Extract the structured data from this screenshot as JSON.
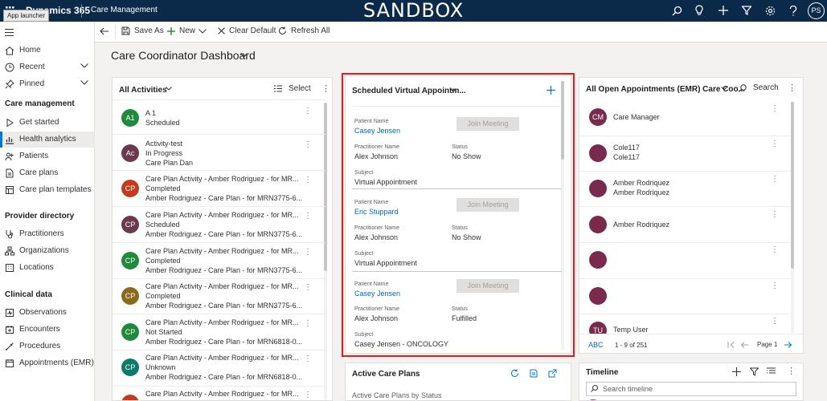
{
  "topbar": {
    "brand": "Dynamics 365",
    "app_name": "Care Management",
    "environment": "SANDBOX",
    "tooltip": "App launcher",
    "user_initials": "PS",
    "icons": [
      "search-icon",
      "lightbulb-icon",
      "plus-icon",
      "filter-icon",
      "gear-icon",
      "help-icon"
    ]
  },
  "sidebar": {
    "top_items": [
      {
        "label": "Home",
        "icon": "home-icon"
      },
      {
        "label": "Recent",
        "icon": "clock-icon"
      },
      {
        "label": "Pinned",
        "icon": "pin-icon"
      }
    ],
    "groups": [
      {
        "title": "Care management",
        "items": [
          {
            "label": "Get started",
            "icon": "play-icon"
          },
          {
            "label": "Health analytics",
            "icon": "chart-icon"
          },
          {
            "label": "Patients",
            "icon": "patients-icon"
          },
          {
            "label": "Care plans",
            "icon": "document-icon"
          },
          {
            "label": "Care plan templates",
            "icon": "template-icon"
          }
        ]
      },
      {
        "title": "Provider directory",
        "items": [
          {
            "label": "Practitioners",
            "icon": "stethoscope-icon"
          },
          {
            "label": "Organizations",
            "icon": "organization-icon"
          },
          {
            "label": "Locations",
            "icon": "location-icon"
          }
        ]
      },
      {
        "title": "Clinical data",
        "items": [
          {
            "label": "Observations",
            "icon": "observation-icon"
          },
          {
            "label": "Encounters",
            "icon": "encounter-icon"
          },
          {
            "label": "Procedures",
            "icon": "procedure-icon"
          },
          {
            "label": "Appointments (EMR)",
            "icon": "calendar-icon"
          }
        ]
      }
    ]
  },
  "commandbar": {
    "save_as": "Save As",
    "new": "New",
    "clear_default": "Clear Default",
    "refresh_all": "Refresh All"
  },
  "page": {
    "title": "Care Coordinator Dashboard"
  },
  "activities": {
    "title": "All Activities",
    "select_label": "Select",
    "rows": [
      {
        "initials": "A1",
        "color": "#1f8a3b",
        "l1": "A 1",
        "l2": "Scheduled",
        "l3": ""
      },
      {
        "initials": "Ac",
        "color": "#6b3a4f",
        "l1": "Activity-test",
        "l2": "In Progress",
        "l3": "Care Plan Dan"
      },
      {
        "initials": "CP",
        "color": "#c43b1c",
        "l1": "Care Plan Activity - Amber Rodriguez - for MR...",
        "l2": "Completed",
        "l3": "Amber Rodriguez - Care Plan - for MRN3775-6..."
      },
      {
        "initials": "CP",
        "color": "#6b3a4f",
        "l1": "Care Plan Activity - Amber Rodriguez - for MR...",
        "l2": "Scheduled",
        "l3": "Amber Rodriguez - Care Plan - for MRN3775-6..."
      },
      {
        "initials": "CP",
        "color": "#1f8a3b",
        "l1": "Care Plan Activity - Amber Rodriguez - for MR...",
        "l2": "Completed",
        "l3": "Amber Rodriguez - Care Plan - for MRN3775-6..."
      },
      {
        "initials": "CP",
        "color": "#8a6a1c",
        "l1": "Care Plan Activity - Amber Rodriguez - for MR...",
        "l2": "Completed",
        "l3": "Amber Rodriguez - Care Plan - for MRN3775-6..."
      },
      {
        "initials": "CP",
        "color": "#1f8a3b",
        "l1": "Care Plan Activity - Amber Rodriguez - for MR...",
        "l2": "Not Started",
        "l3": "Amber Rodriguez - Care Plan - for MRN6818-0..."
      },
      {
        "initials": "CP",
        "color": "#0e7a6a",
        "l1": "Care Plan Activity - Amber Rodriguez - for MR...",
        "l2": "Unknown",
        "l3": "Amber Rodriguez - Care Plan - for MRN6818-0..."
      },
      {
        "initials": "CP",
        "color": "#c43b1c",
        "l1": "Care Plan Activity - Amber Rodriguez - for MR...",
        "l2": "",
        "l3": ""
      }
    ]
  },
  "scheduled": {
    "title": "Scheduled Virtual Appointm...",
    "labels": {
      "patient": "Patient Name",
      "practitioner": "Practitioner Name",
      "status": "Status",
      "subject": "Subject",
      "join": "Join Meeting"
    },
    "cards": [
      {
        "patient": "Casey Jensen",
        "practitioner": "Alex Johnson",
        "status": "No Show",
        "subject": "Virtual Appointment"
      },
      {
        "patient": "Eric Stuppard",
        "practitioner": "Alex Johnson",
        "status": "No Show",
        "subject": "Virtual Appointment"
      },
      {
        "patient": "Casey Jensen",
        "practitioner": "Alex Johnson",
        "status": "Fulfilled",
        "subject": "Casey Jensen - ONCOLOGY"
      }
    ]
  },
  "emr": {
    "title": "All Open Appointments (EMR) Care Coo...",
    "search_label": "Search",
    "rows": [
      {
        "initials": "CM",
        "t1": "Care Manager",
        "t2": ""
      },
      {
        "initials": "",
        "t1": "Cole117",
        "t2": "Cole117"
      },
      {
        "initials": "",
        "t1": "Amber Rodriquez",
        "t2": "Amber Rodriquez"
      },
      {
        "initials": "",
        "t1": "Amber Rodriquez",
        "t2": ""
      },
      {
        "initials": "",
        "t1": "",
        "t2": ""
      },
      {
        "initials": "",
        "t1": "",
        "t2": ""
      },
      {
        "initials": "TU",
        "t1": "Temp User",
        "t2": ""
      }
    ],
    "footer": {
      "abc": "ABC",
      "range": "1 - 9 of 251",
      "page": "Page 1"
    }
  },
  "care_plans": {
    "title": "Active Care Plans",
    "subtitle": "Active Care Plans by Status"
  },
  "timeline": {
    "title": "Timeline",
    "search_placeholder": "Search timeline"
  },
  "colors": {
    "topbar": "#0b2a4a",
    "accent": "#0078d4",
    "highlight_border": "#e31b1b"
  }
}
